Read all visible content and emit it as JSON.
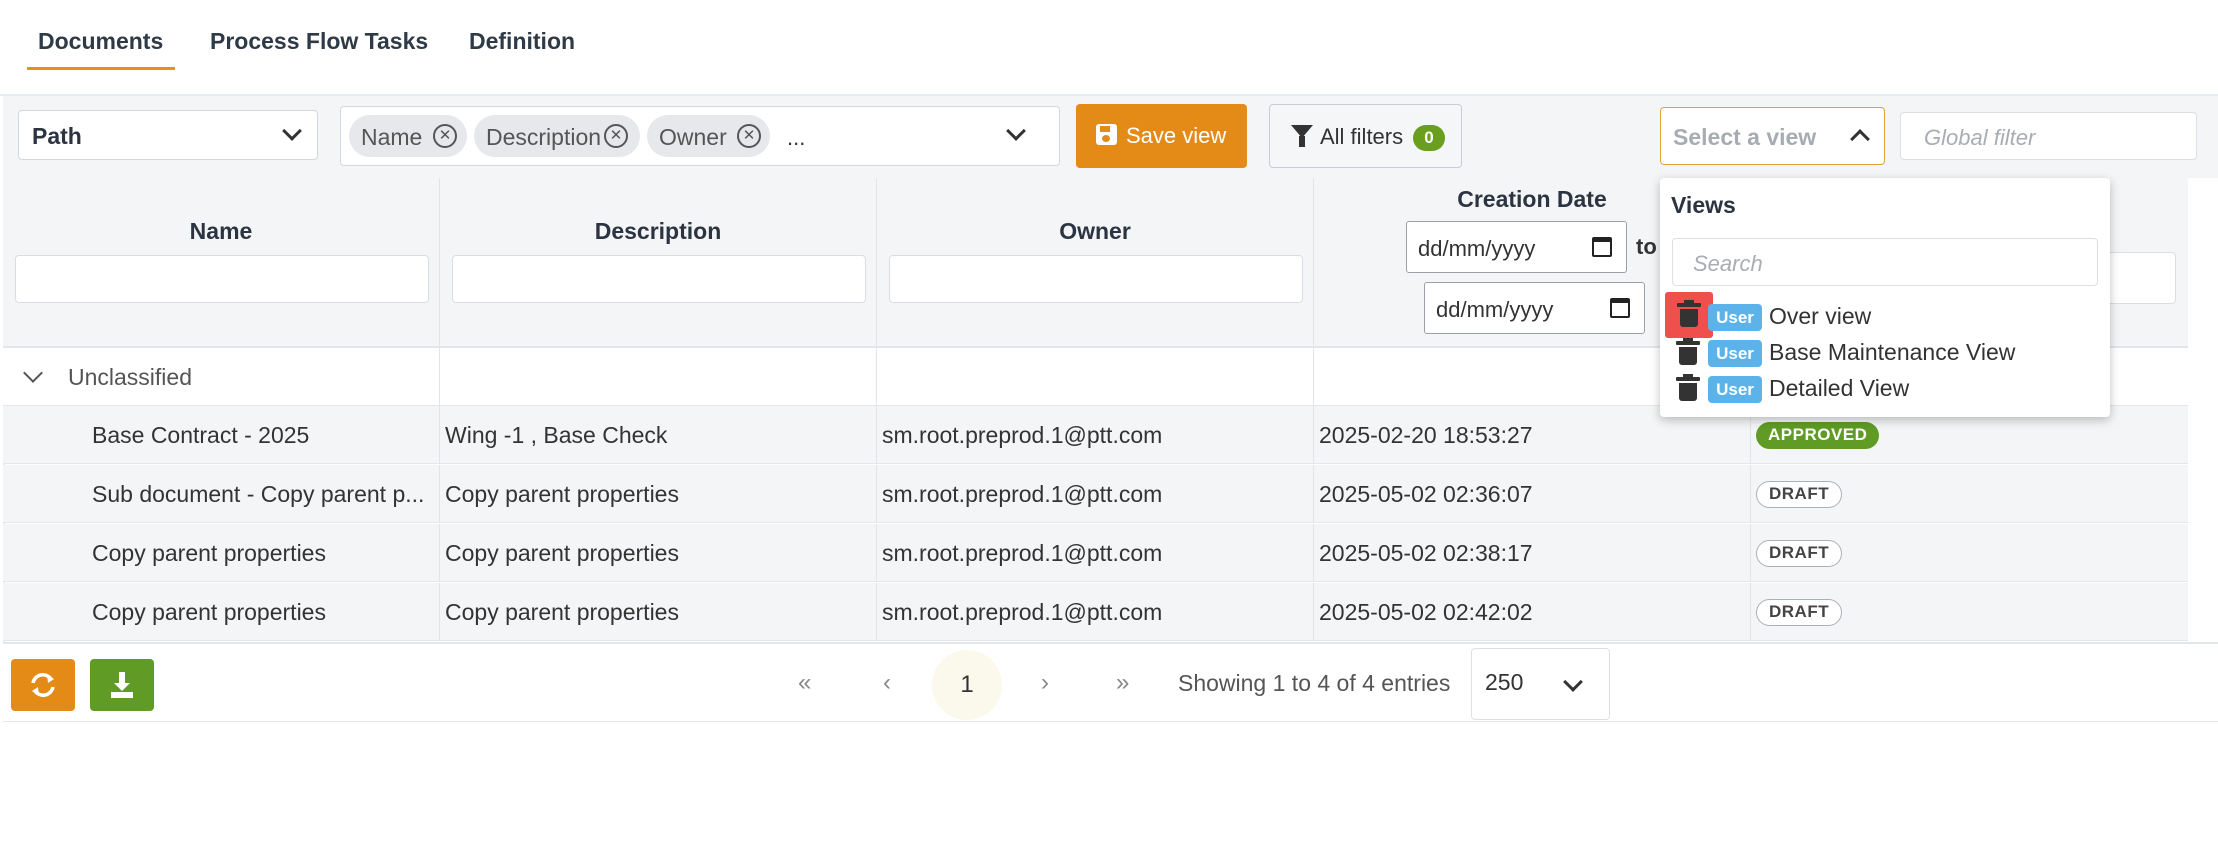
{
  "tabs": [
    {
      "label": "Documents",
      "active": true
    },
    {
      "label": "Process Flow Tasks",
      "active": false
    },
    {
      "label": "Definition",
      "active": false
    }
  ],
  "toolbar": {
    "path_select": "Path",
    "column_chips": [
      "Name",
      "Description",
      "Owner"
    ],
    "column_more": "...",
    "save_view_label": "Save view",
    "all_filters_label": "All filters",
    "filters_count": "0",
    "view_select_placeholder": "Select a view",
    "global_filter_placeholder": "Global filter"
  },
  "table": {
    "columns": [
      "Name",
      "Description",
      "Owner",
      "Creation Date"
    ],
    "date_filter": {
      "from_placeholder": "dd/mm/yyyy",
      "separator": "to",
      "to_placeholder": "dd/mm/yyyy"
    },
    "group_label": "Unclassified",
    "rows": [
      {
        "name": "Base Contract - 2025",
        "description": "Wing -1 , Base Check",
        "owner": "sm.root.preprod.1@ptt.com",
        "created": "2025-02-20 18:53:27",
        "status": "APPROVED"
      },
      {
        "name": "Sub document - Copy parent p...",
        "description": "Copy parent properties",
        "owner": "sm.root.preprod.1@ptt.com",
        "created": "2025-05-02 02:36:07",
        "status": "DRAFT"
      },
      {
        "name": "Copy parent properties",
        "description": "Copy parent properties",
        "owner": "sm.root.preprod.1@ptt.com",
        "created": "2025-05-02 02:38:17",
        "status": "DRAFT"
      },
      {
        "name": "Copy parent properties",
        "description": "Copy parent properties",
        "owner": "sm.root.preprod.1@ptt.com",
        "created": "2025-05-02 02:42:02",
        "status": "DRAFT"
      }
    ]
  },
  "footer": {
    "first": "«",
    "prev": "‹",
    "current_page": "1",
    "next": "›",
    "last": "»",
    "showing": "Showing 1 to 4 of 4 entries",
    "page_size": "250"
  },
  "views_dropdown": {
    "title": "Views",
    "search_placeholder": "Search",
    "items": [
      {
        "badge": "User",
        "label": "Over view"
      },
      {
        "badge": "User",
        "label": "Base Maintenance View"
      },
      {
        "badge": "User",
        "label": "Detailed View"
      }
    ]
  },
  "colors": {
    "accent": "#e38b16",
    "success": "#5f9b25",
    "user_badge": "#5cb3ea",
    "highlight": "#f0504c"
  }
}
